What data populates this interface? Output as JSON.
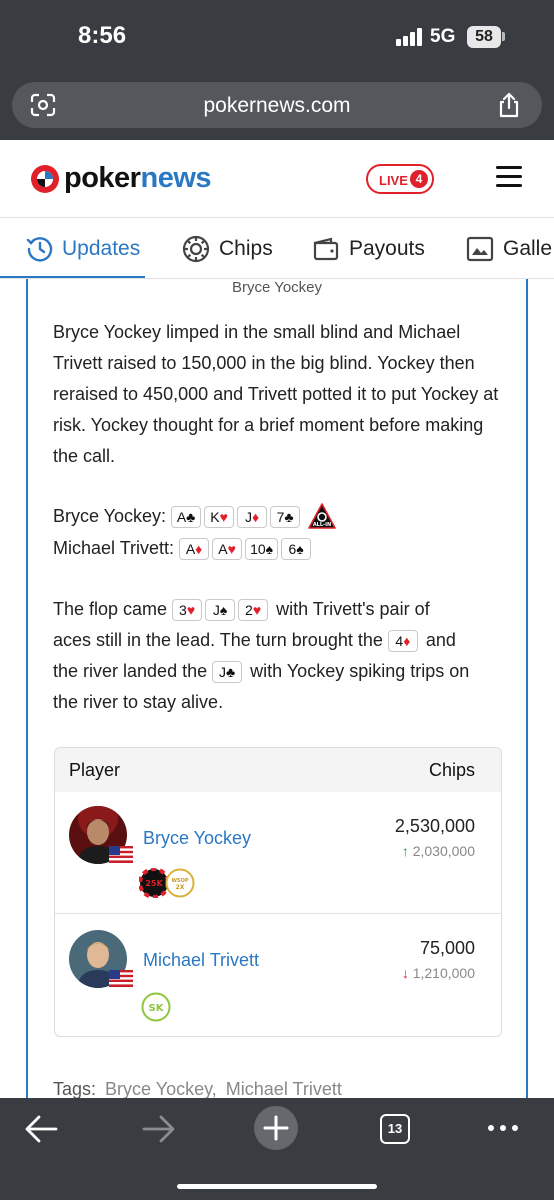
{
  "status": {
    "time": "8:56",
    "network": "5G",
    "battery": "58"
  },
  "browser": {
    "url": "pokernews.com",
    "tab_count": "13"
  },
  "site": {
    "logo_part1": "poker",
    "logo_part2": "news",
    "live_label": "LIVE",
    "live_count": "4",
    "brand_red": "#e0202a",
    "brand_blue": "#2a78c4"
  },
  "tabs": [
    {
      "label": "Updates",
      "active": true,
      "icon": "clock-icon"
    },
    {
      "label": "Chips",
      "active": false,
      "icon": "chip-icon"
    },
    {
      "label": "Payouts",
      "active": false,
      "icon": "wallet-icon"
    },
    {
      "label": "Galle",
      "active": false,
      "icon": "image-icon"
    }
  ],
  "article": {
    "photo_credit": "Bryce Yockey",
    "paragraph1": "Bryce Yockey limped in the small blind and Michael Trivett raised to 150,000 in the big blind. Yockey then reraised to 450,000 and Trivett potted it to put Yockey at risk. Yockey thought for a brief moment before making the call.",
    "hand1": {
      "player": "Bryce Yockey:",
      "cards": [
        {
          "rank": "A",
          "suit": "♣",
          "color": "black"
        },
        {
          "rank": "K",
          "suit": "♥",
          "color": "red"
        },
        {
          "rank": "J",
          "suit": "♦",
          "color": "red"
        },
        {
          "rank": "7",
          "suit": "♣",
          "color": "black"
        }
      ],
      "badge": "ALL-IN"
    },
    "hand2": {
      "player": "Michael Trivett:",
      "cards": [
        {
          "rank": "A",
          "suit": "♦",
          "color": "red"
        },
        {
          "rank": "A",
          "suit": "♥",
          "color": "red"
        },
        {
          "rank": "10",
          "suit": "♠",
          "color": "black"
        },
        {
          "rank": "6",
          "suit": "♠",
          "color": "black"
        }
      ]
    },
    "flop_text": {
      "t1": "The flop came",
      "t2": "with Trivett's pair of",
      "t3": "aces still in the lead. The turn brought the",
      "t4": "and",
      "t5": "the river landed the",
      "t6": "with Yockey spiking trips on",
      "t7": "the river to stay alive."
    },
    "flop_cards": [
      {
        "rank": "3",
        "suit": "♥",
        "color": "red"
      },
      {
        "rank": "J",
        "suit": "♠",
        "color": "black"
      },
      {
        "rank": "2",
        "suit": "♥",
        "color": "red"
      }
    ],
    "turn_card": {
      "rank": "4",
      "suit": "♦",
      "color": "red"
    },
    "river_card": {
      "rank": "J",
      "suit": "♣",
      "color": "black"
    }
  },
  "chip_table": {
    "header_player": "Player",
    "header_chips": "Chips",
    "rows": [
      {
        "name": "Bryce Yockey",
        "chips": "2,530,000",
        "delta": "2,030,000",
        "direction": "up",
        "badges": [
          "25K",
          "WSOP 2X"
        ]
      },
      {
        "name": "Michael Trivett",
        "chips": "75,000",
        "delta": "1,210,000",
        "direction": "down",
        "badges": [
          "SK"
        ]
      }
    ]
  },
  "tags": {
    "label": "Tags:",
    "items": [
      "Bryce Yockey,",
      "Michael Trivett"
    ]
  }
}
